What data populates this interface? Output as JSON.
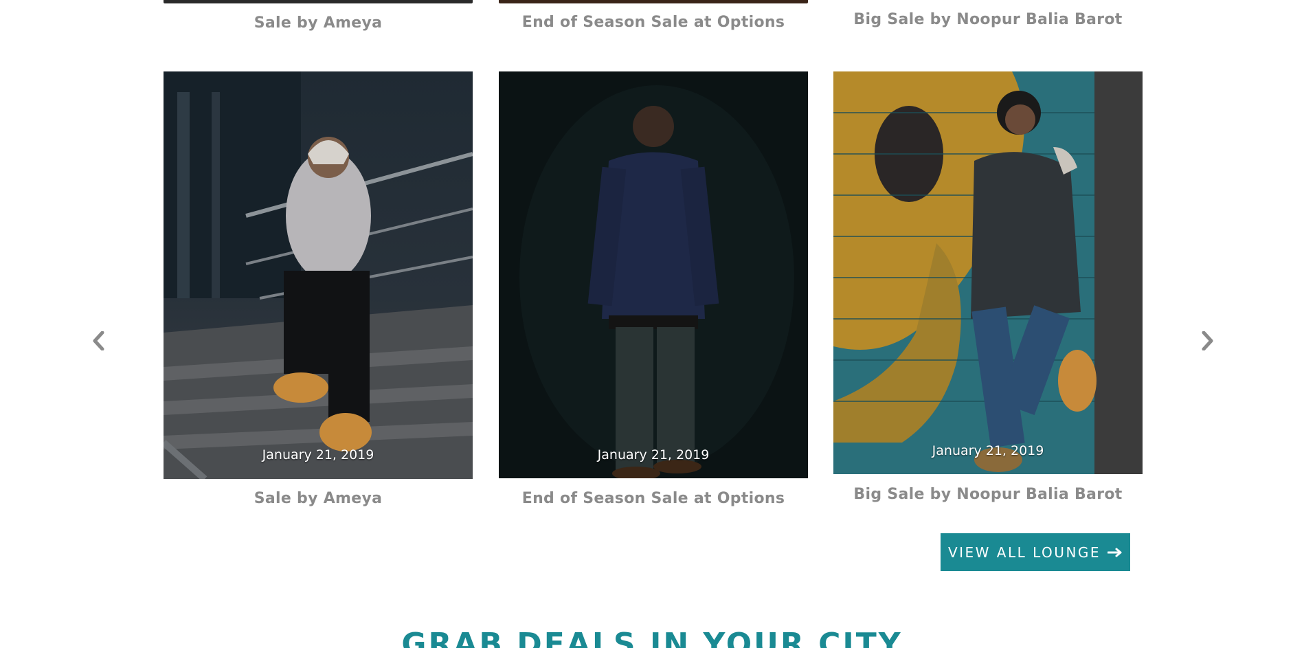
{
  "cards_top_row": [
    {
      "title": "Sale by Ameya"
    },
    {
      "title": "End of Season Sale at Options"
    },
    {
      "title": "Big Sale by Noopur Balia Barot"
    }
  ],
  "cards": [
    {
      "title": "Sale by Ameya",
      "date": "January 21, 2019"
    },
    {
      "title": "End of Season Sale at Options",
      "date": "January 21, 2019"
    },
    {
      "title": "Big Sale by Noopur Balia Barot",
      "date": "January 21, 2019"
    }
  ],
  "carousel": {
    "prev_icon": "chevron-left-icon",
    "next_icon": "chevron-right-icon"
  },
  "view_all": {
    "label": "VIEW ALL LOUNGE",
    "icon": "arrow-right-icon"
  },
  "section": {
    "title": "GRAB DEALS IN YOUR CITY"
  },
  "colors": {
    "accent": "#1a8a93",
    "caption": "#8a8a8a"
  }
}
